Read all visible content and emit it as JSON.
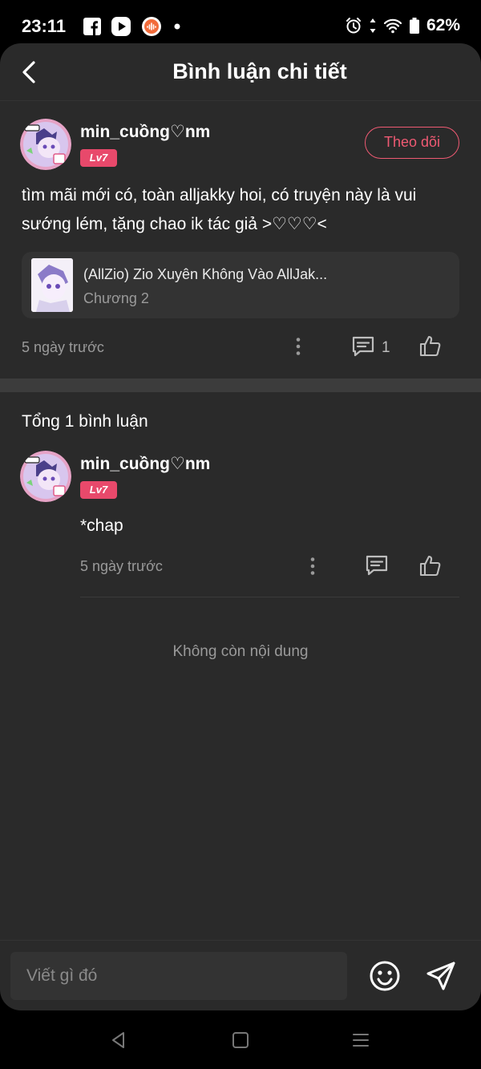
{
  "status_bar": {
    "time": "23:11",
    "battery": "62%"
  },
  "header": {
    "title": "Bình luận chi tiết"
  },
  "post": {
    "username": "min_cuồng♡nm",
    "level": "Lv7",
    "follow_label": "Theo dõi",
    "text": "tìm mãi mới có, toàn alljakky hoi, có truyện này là vui sướng lém, tặng chao ik tác giả >♡♡♡<",
    "story": {
      "title": "(AllZio) Zio Xuyên Không Vào AllJak...",
      "chapter": "Chương 2"
    },
    "time": "5 ngày trước",
    "reply_count": "1"
  },
  "comments": {
    "total_label": "Tổng 1 bình luận",
    "items": [
      {
        "username": "min_cuồng♡nm",
        "level": "Lv7",
        "text": "*chap",
        "time": "5 ngày trước"
      }
    ],
    "end_label": "Không còn nội dung"
  },
  "composer": {
    "placeholder": "Viết gì đó"
  },
  "colors": {
    "accent": "#ef5a73",
    "badge": "#e8496b",
    "background": "#2a2a2a"
  }
}
